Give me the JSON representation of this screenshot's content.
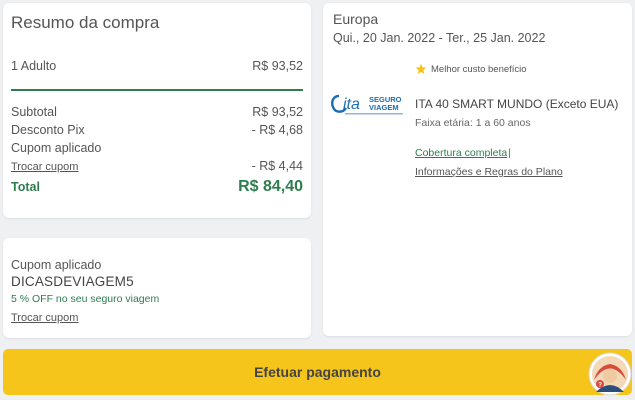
{
  "summary": {
    "title": "Resumo da compra",
    "adult_label": "1 Adulto",
    "adult_value": "R$ 93,52",
    "subtotal_label": "Subtotal",
    "subtotal_value": "R$ 93,52",
    "pix_label": "Desconto Pix",
    "pix_value": "- R$ 4,68",
    "coupon_label": "Cupom aplicado",
    "change_coupon": "Trocar cupom",
    "coupon_value": "- R$ 4,44",
    "total_label": "Total",
    "total_value": "R$ 84,40"
  },
  "coupon": {
    "label": "Cupom aplicado",
    "code": "DICASDEVIAGEM5",
    "discount_text": "5 % OFF no seu seguro viagem",
    "change_link": "Trocar cupom"
  },
  "plan": {
    "destination": "Europa",
    "dates": "Qui., 20 Jan. 2022 - Ter., 25 Jan. 2022",
    "badge": "Melhor custo benefício",
    "logo_text_ita": "ita",
    "logo_text_seguro": "SEGURO",
    "logo_text_viagem": "VIAGEM",
    "name": "ITA 40 SMART MUNDO (Exceto EUA)",
    "age_range": "Faixa etária: 1 a 60 anos",
    "coverage_link": "Cobertura completa",
    "separator": "|",
    "rules_link": "Informações e Regras do Plano"
  },
  "actions": {
    "pay_label": "Efetuar pagamento"
  },
  "colors": {
    "accent_green": "#2e7d4f",
    "pay_yellow": "#f6c51b",
    "logo_blue": "#1c6db3"
  },
  "icons": {
    "badge": "star-icon",
    "avatar": "support-avatar-icon"
  }
}
